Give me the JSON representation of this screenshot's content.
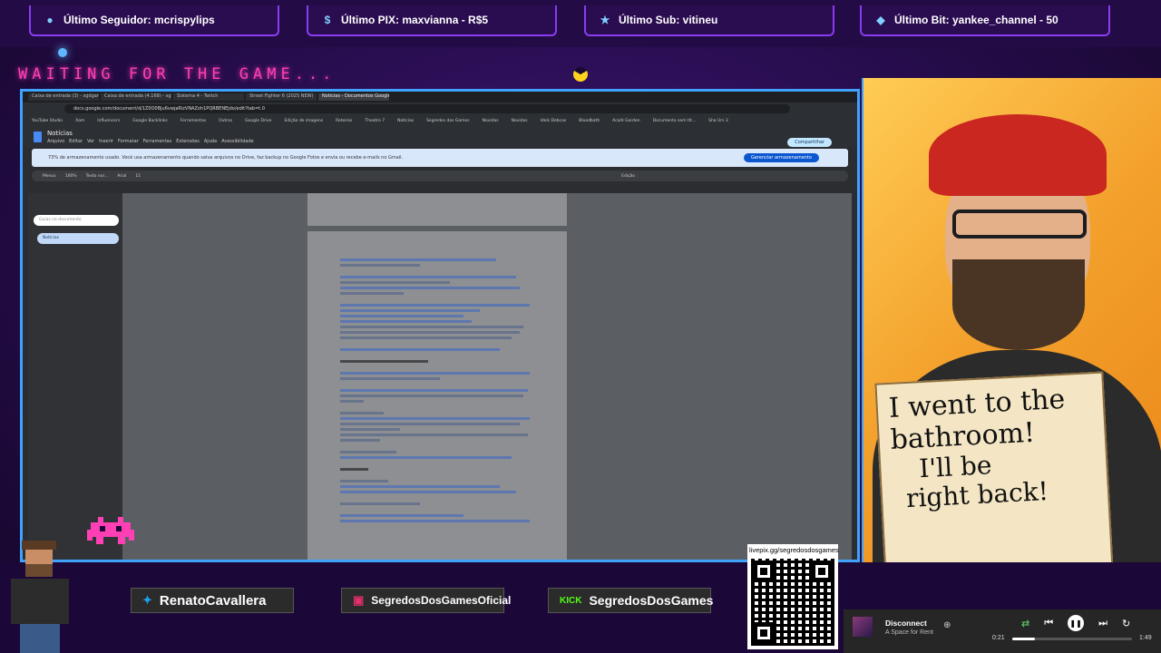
{
  "ticker": {
    "follower": "Último Seguidor: mcrispylips",
    "pix": "Último PIX: maxvianna - R$5",
    "sub": "Último Sub: vitineu",
    "bit": "Último Bit: yankee_channel - 50"
  },
  "waiting_text": "WAITING FOR THE GAME...",
  "browser": {
    "tabs": [
      "Caixa de entrada (3) - sgdgame",
      "Caixa de entrada (4.168) - sgh",
      "Sistema 4 - Twitch",
      "Street Fighter 6 (2025 NEW)",
      "Notícias - Documentos Google"
    ],
    "url": "docs.google.com/document/d/1Z0O0Bju6vwjaRlzVNAZoh1PQRBENEjdo/edit?tab=t.0",
    "bookmarks": [
      "YouTube Studio",
      "Xam",
      "Influencers",
      "Google Backlinks",
      "Ferramentas",
      "Outros",
      "Google Drive",
      "Edição de imagens",
      "Roteiros",
      "Theatro 7",
      "Notícias",
      "Segredos dos Games",
      "Novidas",
      "Novidas",
      "Idols Debcas",
      "Bloodbath",
      "Acaiti Garden",
      "Documento sem tít...",
      "Sha Urs 3"
    ]
  },
  "docs": {
    "title": "Notícias",
    "menu": [
      "Arquivo",
      "Editar",
      "Ver",
      "Inserir",
      "Formatar",
      "Ferramentas",
      "Extensões",
      "Ajuda",
      "Acessibilidade"
    ],
    "share_label": "Compartilhar",
    "storage_warning": "73% de armazenamento usado. Você usa armazenamento quando salva arquivos no Drive, faz backup no Google Fotos e envia ou recebe e-mails no Gmail.",
    "storage_button": "Gerenciar armazenamento",
    "toolbar": {
      "menus": "Menus",
      "zoom": "100%",
      "style": "Texto nor...",
      "font": "Arial",
      "size": "11",
      "mode": "Edição"
    },
    "outline_search": "Guias no documento",
    "outline_item": "Notícias"
  },
  "sign": {
    "line1": "I went to the",
    "line2": "bathroom!",
    "line3": "I'll be",
    "line4": "right back!"
  },
  "socials": {
    "twitter": "RenatoCavallera",
    "instagram": "SegredosDosGamesOficial",
    "kick_tag": "KICK",
    "kick": "SegredosDosGames"
  },
  "qr_url": "livepix.gg/segredosdosgames",
  "player": {
    "title": "Disconnect",
    "artist": "A Space for Rent",
    "elapsed": "0:21",
    "duration": "1:49",
    "progress": 0.19
  },
  "colors": {
    "accent": "#3fa2ff",
    "pink": "#ff3fb4",
    "purple": "#8a3cf0"
  }
}
